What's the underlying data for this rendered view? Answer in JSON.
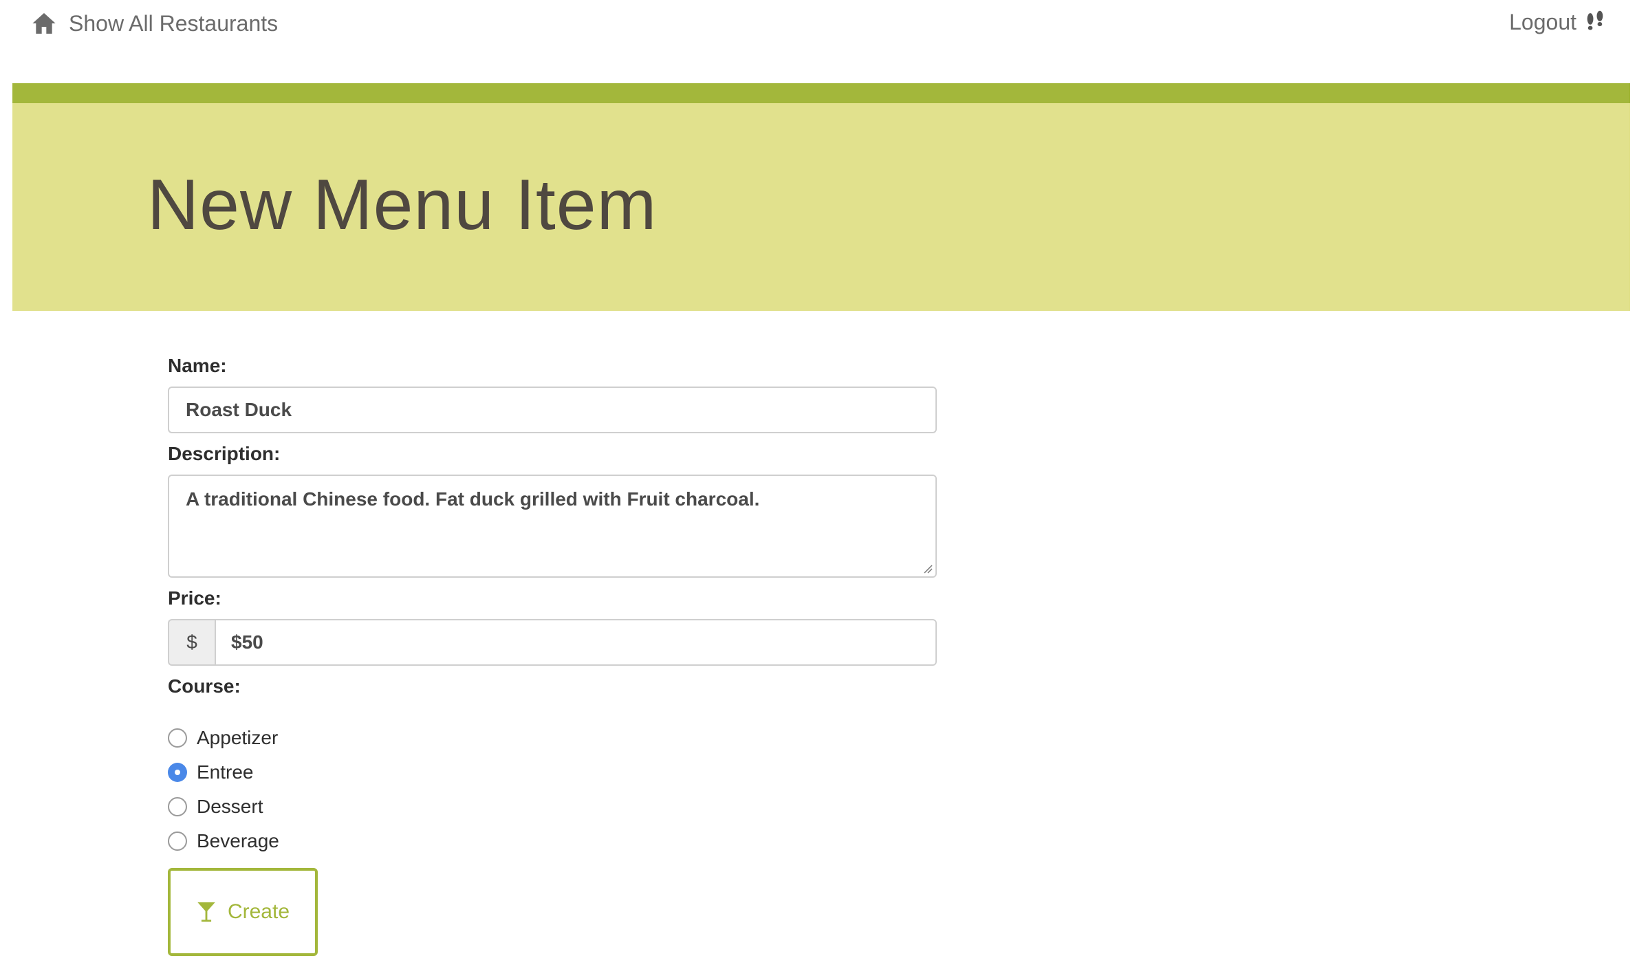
{
  "nav": {
    "home_label": "Show All Restaurants",
    "home_icon": "home-icon",
    "logout_label": "Logout",
    "logout_icon": "footprints-icon"
  },
  "banner": {
    "title": "New Menu Item",
    "stripe_color": "#a3b73b",
    "background_color": "#e1e18d"
  },
  "form": {
    "name_label": "Name:",
    "name_value": "Roast Duck",
    "description_label": "Description:",
    "description_value": "A traditional Chinese food. Fat duck grilled with Fruit charcoal.",
    "price_label": "Price:",
    "price_addon": "$",
    "price_value": "$50",
    "course_label": "Course:",
    "course_options": [
      {
        "label": "Appetizer",
        "checked": false
      },
      {
        "label": "Entree",
        "checked": true
      },
      {
        "label": "Dessert",
        "checked": false
      },
      {
        "label": "Beverage",
        "checked": false
      }
    ],
    "submit_label": "Create",
    "submit_icon": "cocktail-glass-icon"
  }
}
